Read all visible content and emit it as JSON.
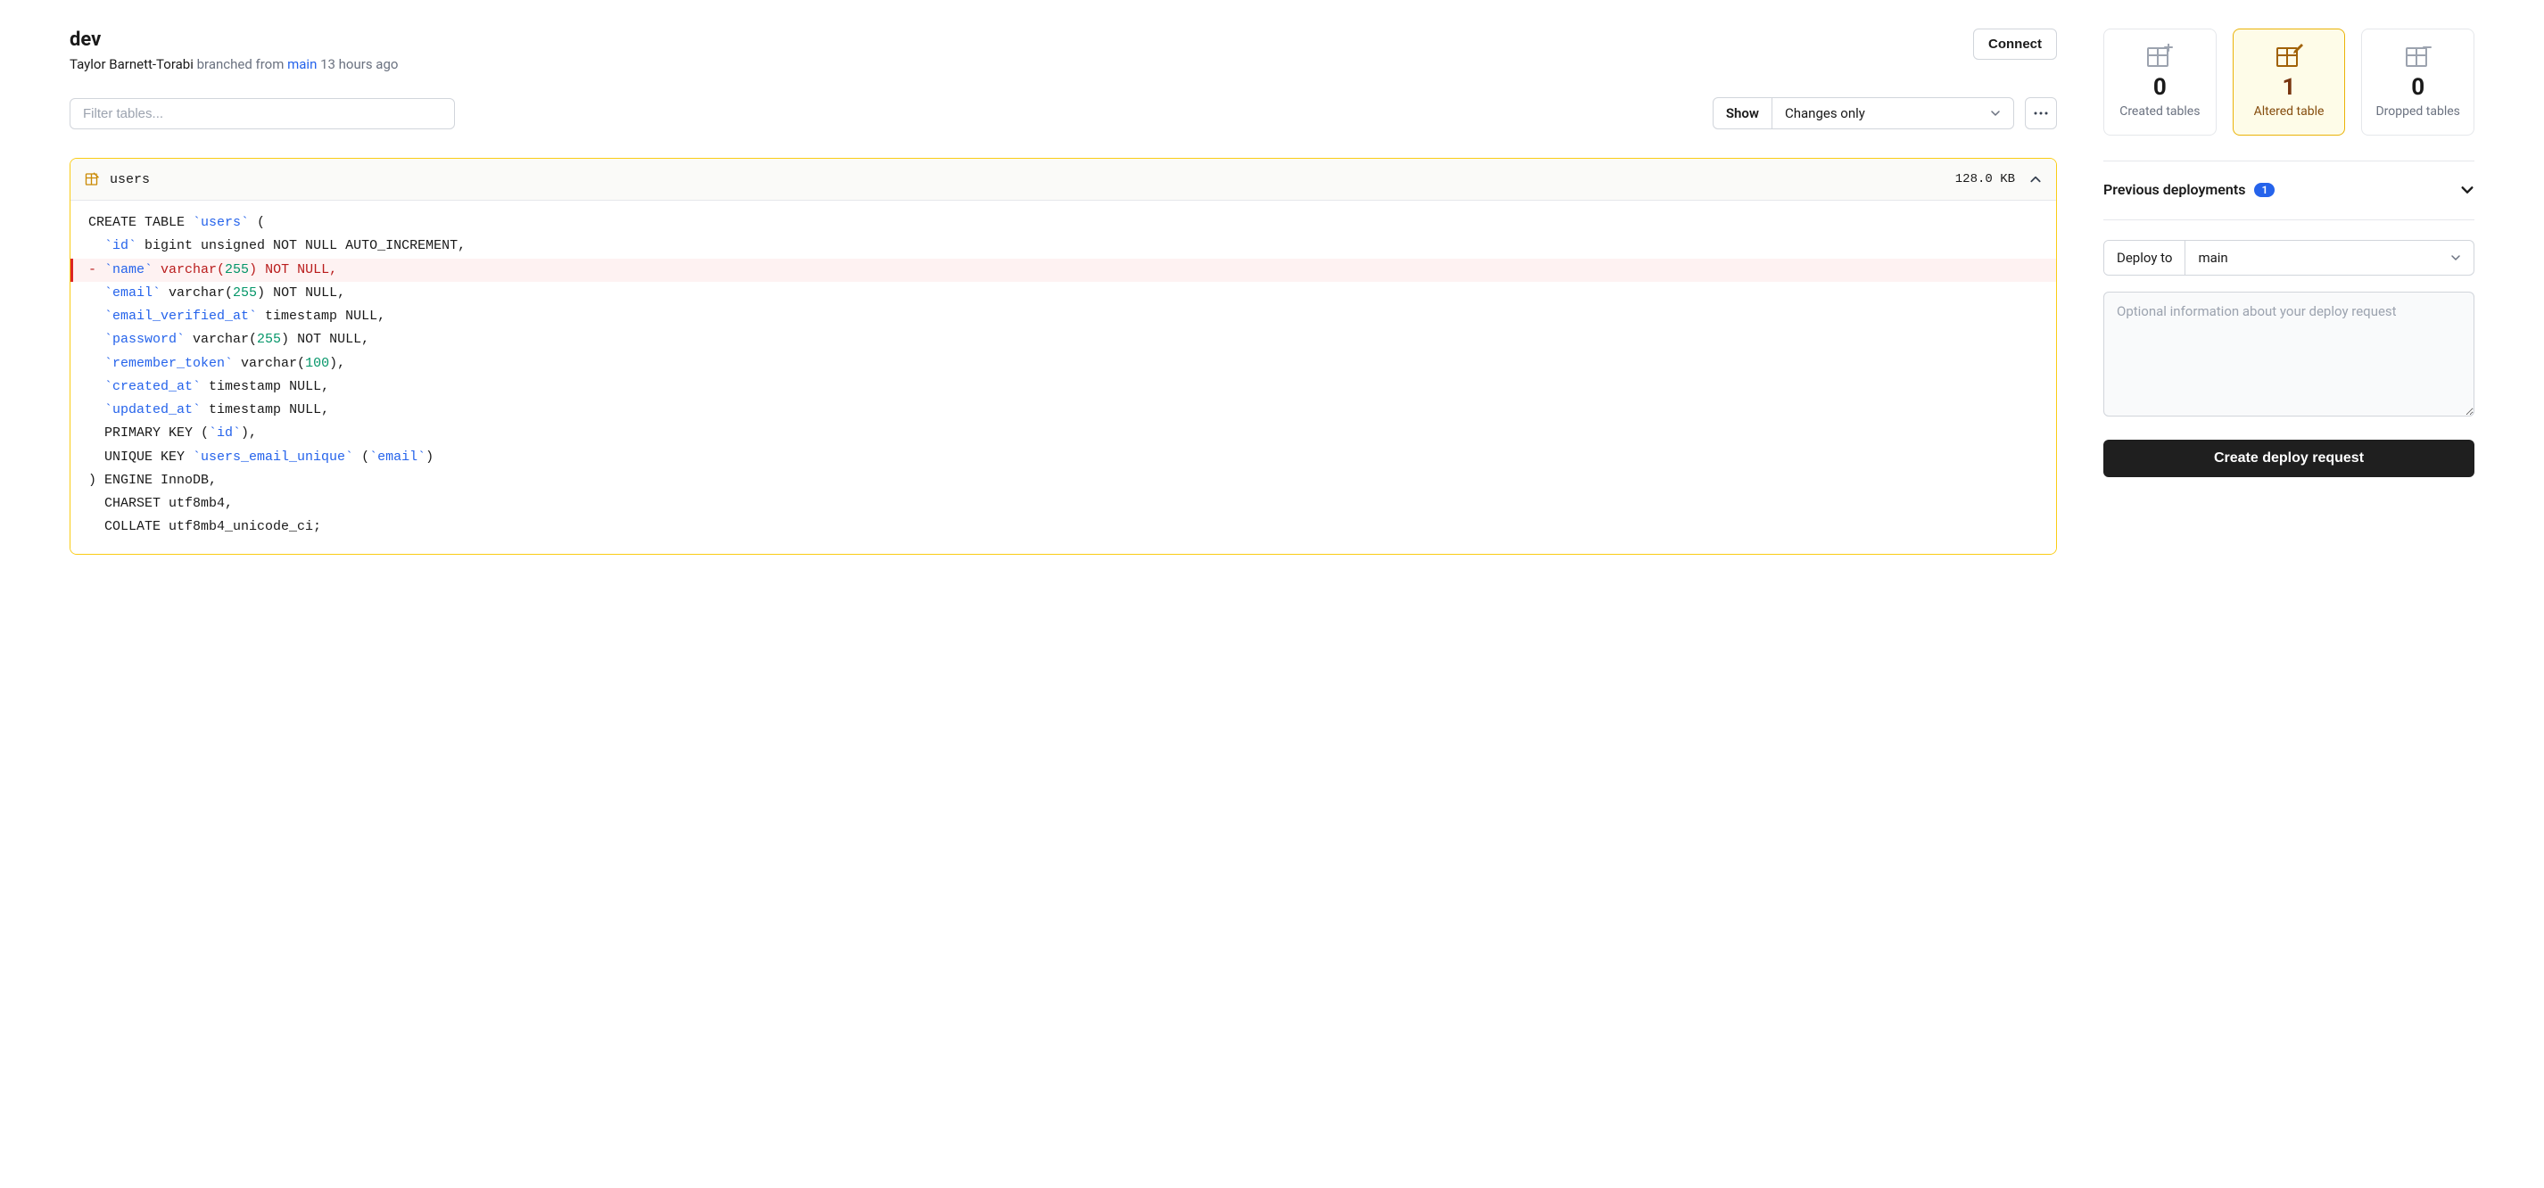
{
  "header": {
    "branch_name": "dev",
    "author": "Taylor Barnett-Torabi",
    "action_text": "branched from",
    "parent_branch": "main",
    "time_ago": "13 hours ago",
    "connect_label": "Connect"
  },
  "filter": {
    "placeholder": "Filter tables...",
    "show_label": "Show",
    "show_value": "Changes only"
  },
  "table": {
    "name": "users",
    "size": "128.0 KB",
    "lines": [
      {
        "type": "ctx",
        "html": "CREATE TABLE <span class='tok-ident'>`users`</span> ("
      },
      {
        "type": "ctx",
        "html": "  <span class='tok-ident'>`id`</span> bigint unsigned NOT NULL AUTO_INCREMENT,"
      },
      {
        "type": "removed",
        "html": "- <span class='tok-ident'>`name`</span> varchar(<span class='tok-num'>255</span>) NOT NULL,"
      },
      {
        "type": "ctx",
        "html": "  <span class='tok-ident'>`email`</span> varchar(<span class='tok-num'>255</span>) NOT NULL,"
      },
      {
        "type": "ctx",
        "html": "  <span class='tok-ident'>`email_verified_at`</span> timestamp NULL,"
      },
      {
        "type": "ctx",
        "html": "  <span class='tok-ident'>`password`</span> varchar(<span class='tok-num'>255</span>) NOT NULL,"
      },
      {
        "type": "ctx",
        "html": "  <span class='tok-ident'>`remember_token`</span> varchar(<span class='tok-num'>100</span>),"
      },
      {
        "type": "ctx",
        "html": "  <span class='tok-ident'>`created_at`</span> timestamp NULL,"
      },
      {
        "type": "ctx",
        "html": "  <span class='tok-ident'>`updated_at`</span> timestamp NULL,"
      },
      {
        "type": "ctx",
        "html": "  PRIMARY KEY (<span class='tok-ident'>`id`</span>),"
      },
      {
        "type": "ctx",
        "html": "  UNIQUE KEY <span class='tok-ident'>`users_email_unique`</span> (<span class='tok-ident'>`email`</span>)"
      },
      {
        "type": "ctx",
        "html": ") ENGINE InnoDB,"
      },
      {
        "type": "ctx",
        "html": "  CHARSET utf8mb4,"
      },
      {
        "type": "ctx",
        "html": "  COLLATE utf8mb4_unicode_ci;"
      }
    ]
  },
  "stats": {
    "created": {
      "count": "0",
      "label": "Created tables"
    },
    "altered": {
      "count": "1",
      "label": "Altered table"
    },
    "dropped": {
      "count": "0",
      "label": "Dropped tables"
    }
  },
  "previous_deployments": {
    "title": "Previous deployments",
    "count": "1"
  },
  "deploy": {
    "deploy_to_label": "Deploy to",
    "deploy_to_value": "main",
    "textarea_placeholder": "Optional information about your deploy request",
    "submit_label": "Create deploy request"
  }
}
